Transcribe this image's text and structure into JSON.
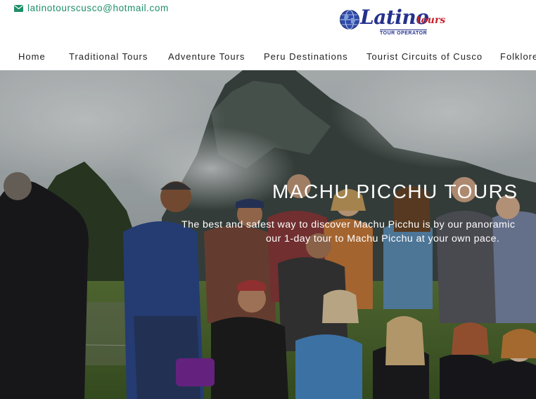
{
  "header": {
    "email": "latinotourscusco@hotmail.com",
    "email_icon": "envelope-icon",
    "logo": {
      "brand": "Latino",
      "brand_suffix": "tours",
      "tagline": "TOUR OPERATOR",
      "globe_icon": "globe-icon"
    }
  },
  "nav": {
    "items": [
      {
        "label": "Home"
      },
      {
        "label": "Traditional Tours"
      },
      {
        "label": "Adventure Tours"
      },
      {
        "label": "Peru Destinations"
      },
      {
        "label": "Tourist Circuits of Cusco"
      },
      {
        "label": "Folklore"
      }
    ]
  },
  "hero": {
    "title": "MACHU PICCHU TOURS",
    "subtitle_line1": "The best and safest way to discover Machu Picchu is by our panoramic",
    "subtitle_line2": "our 1-day tour to Machu Picchu at your own pace."
  },
  "colors": {
    "accent_green": "#1e8f6a",
    "logo_blue": "#24318c",
    "logo_red": "#c8232c",
    "nav_text": "#222222"
  }
}
